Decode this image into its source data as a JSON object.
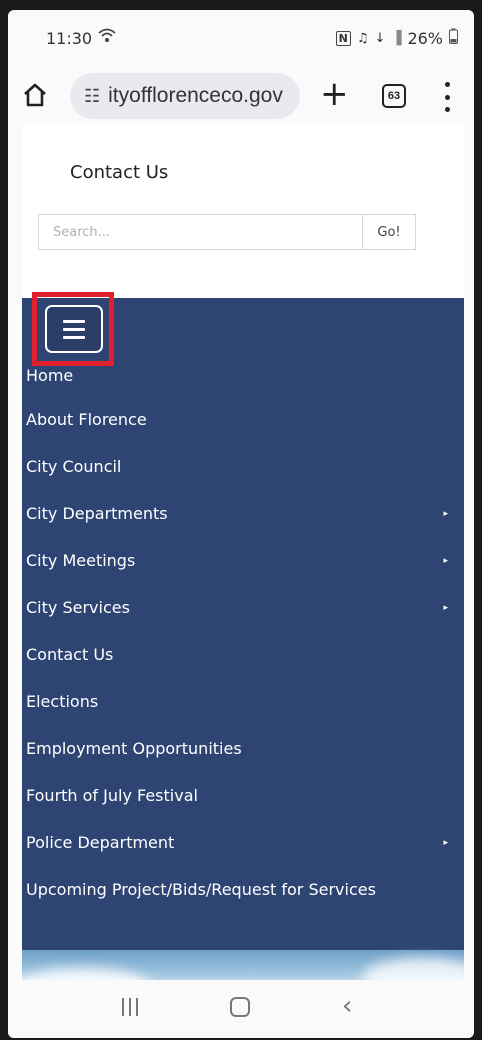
{
  "status_bar": {
    "time": "11:30",
    "wifi_icon": "wifi-icon",
    "nfc_icon": "N",
    "mute_icon": "♫",
    "signal_text": "↓",
    "signal_bars": "▐",
    "battery": "26%"
  },
  "browser": {
    "url": "ityofflorenceco.gov",
    "site_info_icon": "☷",
    "new_tab": "+",
    "tab_count": "63"
  },
  "page": {
    "contact_link": "Contact Us",
    "search": {
      "placeholder": "Search...",
      "button": "Go!"
    },
    "nav_items": [
      {
        "label": "Home",
        "submenu": false
      },
      {
        "label": "About Florence",
        "submenu": false
      },
      {
        "label": "City Council",
        "submenu": false
      },
      {
        "label": "City Departments",
        "submenu": true
      },
      {
        "label": "City Meetings",
        "submenu": true
      },
      {
        "label": "City Services",
        "submenu": true
      },
      {
        "label": "Contact Us",
        "submenu": false
      },
      {
        "label": "Elections",
        "submenu": false
      },
      {
        "label": "Employment Opportunities",
        "submenu": false
      },
      {
        "label": "Fourth of July Festival",
        "submenu": false
      },
      {
        "label": "Police Department",
        "submenu": true
      },
      {
        "label": "Upcoming Project/Bids/Request for Services",
        "submenu": false
      }
    ],
    "caret": "▸"
  },
  "colors": {
    "nav_bg": "#2e4574",
    "highlight": "#e0202c"
  },
  "system_nav": {
    "back": "‹"
  }
}
